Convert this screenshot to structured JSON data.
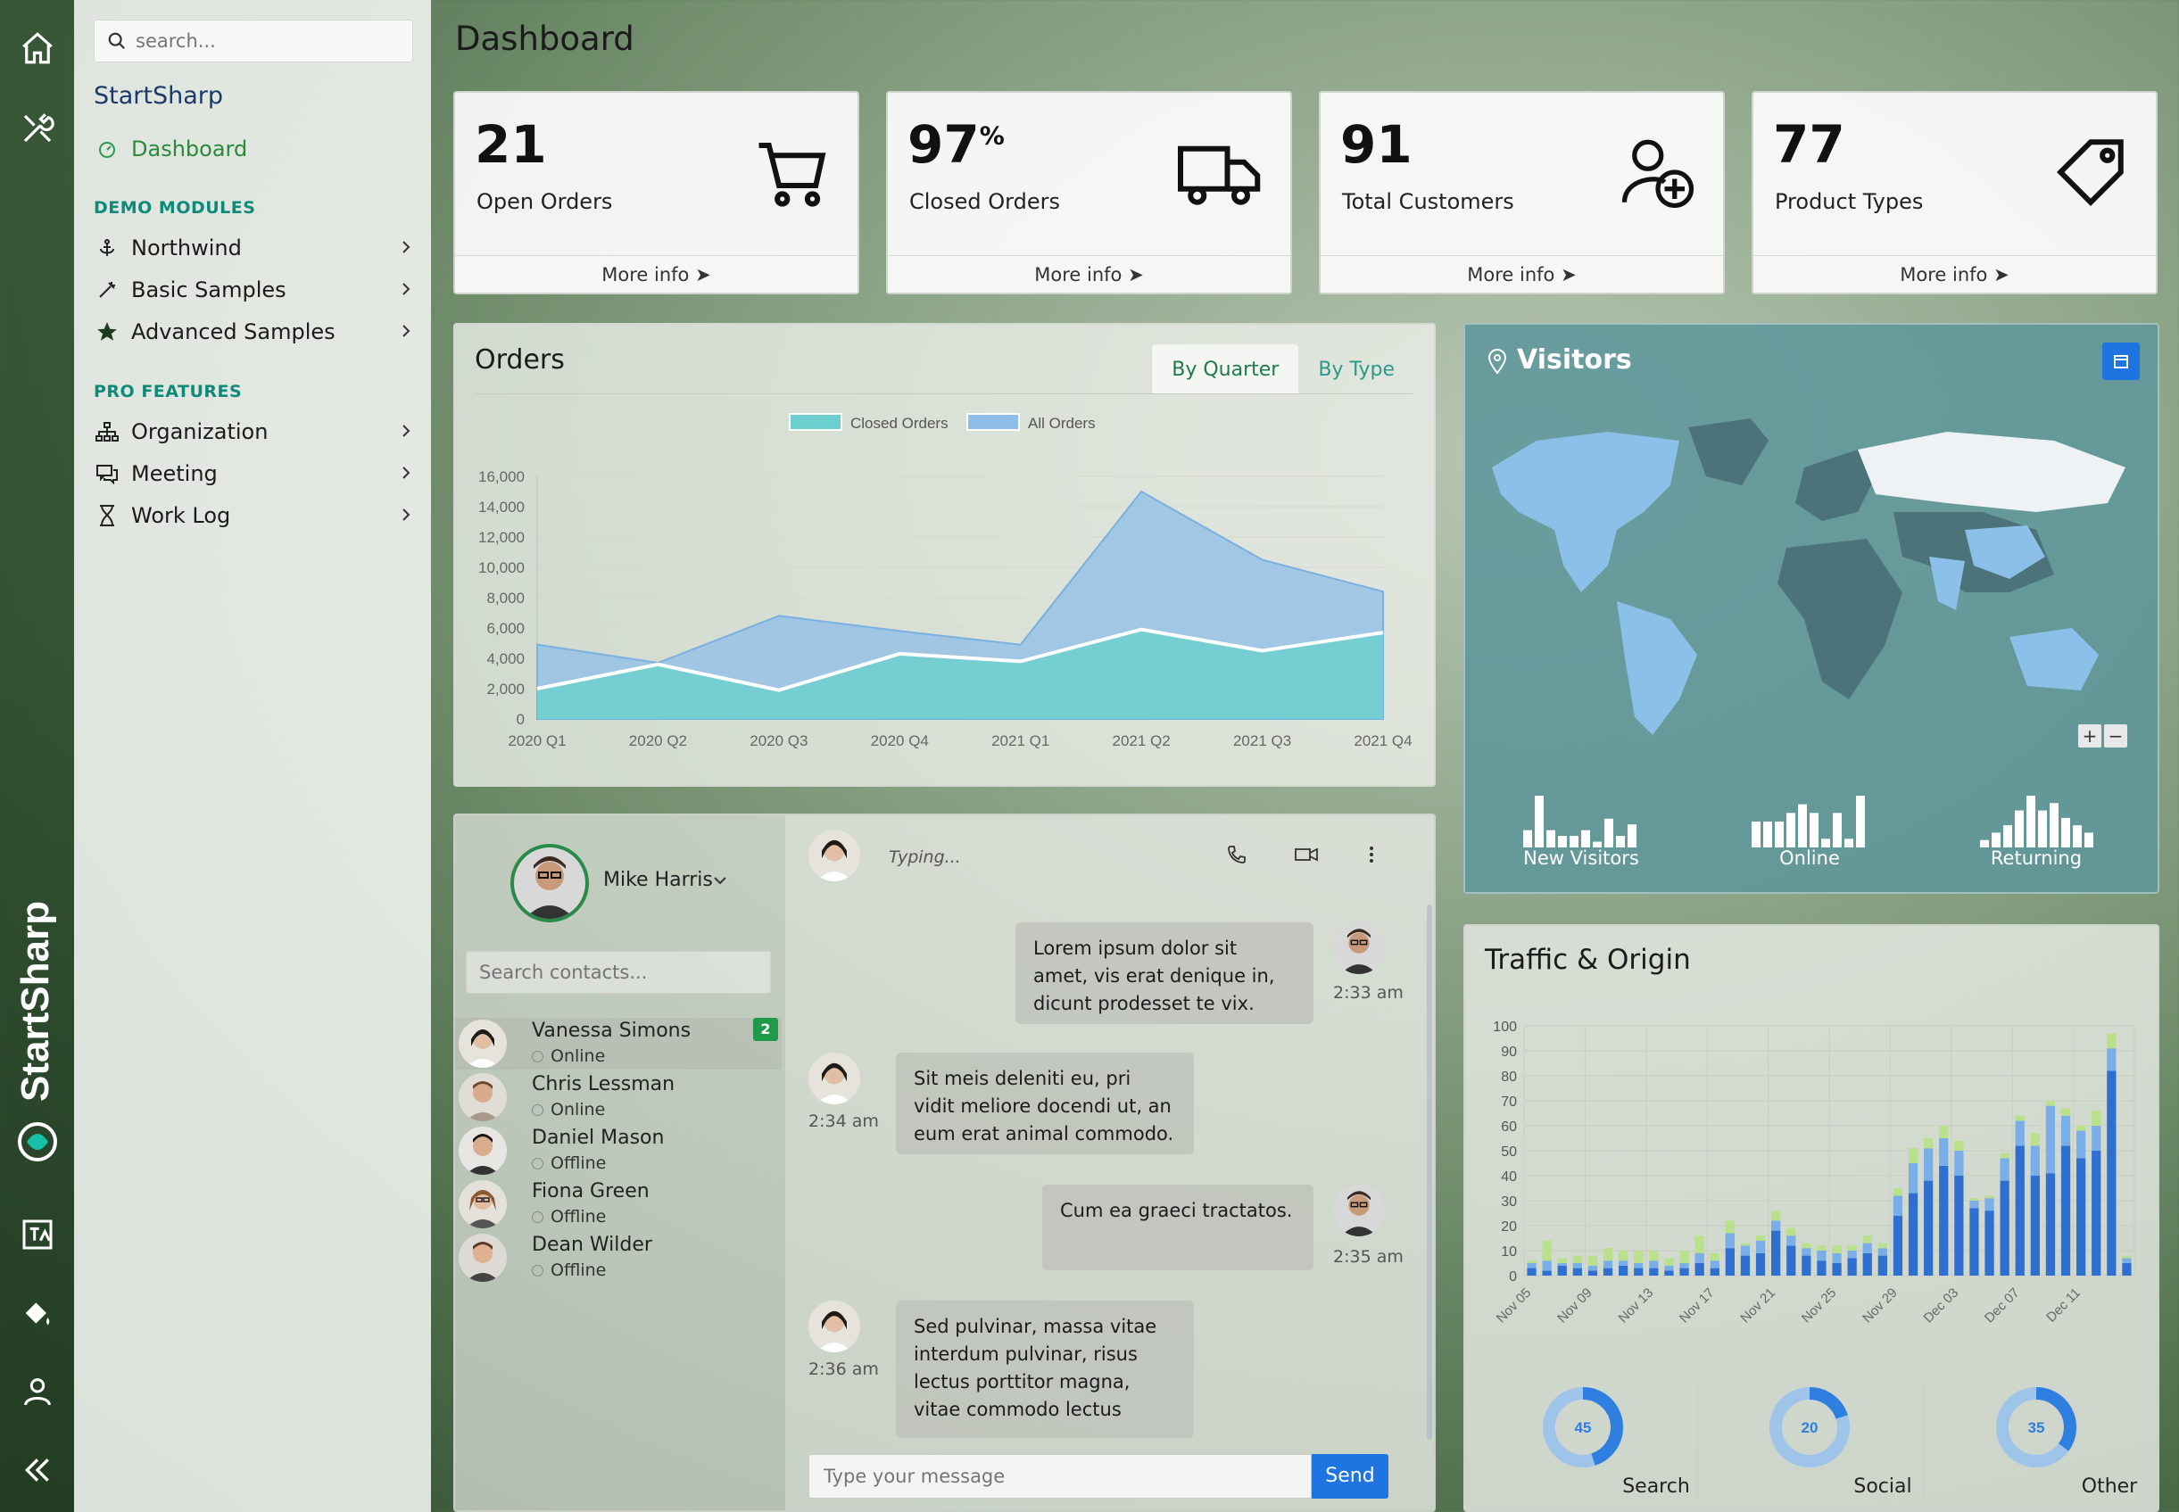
{
  "rail": {
    "brand_text": "StartSharp",
    "icons": [
      "home-icon",
      "tools-icon",
      "translate-icon",
      "paint-bucket-icon",
      "user-icon",
      "collapse-icon"
    ]
  },
  "sidebar": {
    "search_placeholder": "search...",
    "brand": "StartSharp",
    "dashboard_label": "Dashboard",
    "demo_heading": "DEMO MODULES",
    "demo_items": [
      {
        "label": "Northwind",
        "icon": "anchor-icon"
      },
      {
        "label": "Basic Samples",
        "icon": "magic-wand-icon"
      },
      {
        "label": "Advanced Samples",
        "icon": "star-icon"
      }
    ],
    "pro_heading": "PRO FEATURES",
    "pro_items": [
      {
        "label": "Organization",
        "icon": "sitemap-icon"
      },
      {
        "label": "Meeting",
        "icon": "chat-icon"
      },
      {
        "label": "Work Log",
        "icon": "hourglass-icon"
      }
    ]
  },
  "page": {
    "title": "Dashboard"
  },
  "stats": [
    {
      "value": "21",
      "suffix": "",
      "label": "Open Orders",
      "more": "More info",
      "icon": "cart-icon"
    },
    {
      "value": "97",
      "suffix": "%",
      "label": "Closed Orders",
      "more": "More info",
      "icon": "truck-icon"
    },
    {
      "value": "91",
      "suffix": "",
      "label": "Total Customers",
      "more": "More info",
      "icon": "add-user-icon"
    },
    {
      "value": "77",
      "suffix": "",
      "label": "Product Types",
      "more": "More info",
      "icon": "tag-icon"
    }
  ],
  "orders": {
    "title": "Orders",
    "tabs": [
      "By Quarter",
      "By Type"
    ],
    "active_tab": "By Quarter"
  },
  "chart_data": [
    {
      "type": "area",
      "categories": [
        "2020 Q1",
        "2020 Q2",
        "2020 Q3",
        "2020 Q4",
        "2021 Q1",
        "2021 Q2",
        "2021 Q3",
        "2021 Q4"
      ],
      "series": [
        {
          "name": "Closed Orders",
          "values": [
            2000,
            3600,
            1900,
            4300,
            3800,
            5900,
            4500,
            5700
          ],
          "color": "#6ccfcf"
        },
        {
          "name": "All Orders",
          "values": [
            4900,
            3700,
            6800,
            5800,
            4900,
            15000,
            10500,
            8400
          ],
          "color": "#8dbde8"
        }
      ],
      "ylim": [
        0,
        16000
      ],
      "yticks": [
        "0",
        "2,000",
        "4,000",
        "6,000",
        "8,000",
        "10,000",
        "12,000",
        "14,000",
        "16,000"
      ],
      "legend": "top",
      "grid": true
    },
    {
      "type": "bar",
      "stacked": true,
      "categories": [
        "Nov 05",
        "Nov 09",
        "Nov 13",
        "Nov 17",
        "Nov 21",
        "Nov 25",
        "Nov 29",
        "Dec 03",
        "Dec 07",
        "Dec 11"
      ],
      "x_count": 40,
      "series": [
        {
          "name": "Search",
          "color": "#2e6fd0",
          "values": [
            3,
            2,
            4,
            3,
            2,
            3,
            4,
            3,
            3,
            2,
            3,
            5,
            3,
            11,
            8,
            9,
            18,
            12,
            8,
            6,
            5,
            7,
            9,
            8,
            24,
            33,
            38,
            44,
            40,
            27,
            26,
            38,
            52,
            40,
            41,
            52,
            47,
            50,
            82,
            5
          ]
        },
        {
          "name": "Social",
          "color": "#7aaee8",
          "values": [
            2,
            4,
            1,
            2,
            2,
            3,
            2,
            2,
            3,
            2,
            2,
            4,
            3,
            6,
            4,
            5,
            4,
            4,
            3,
            4,
            4,
            3,
            4,
            3,
            8,
            12,
            13,
            11,
            10,
            3,
            5,
            9,
            10,
            12,
            27,
            12,
            11,
            10,
            9,
            2
          ]
        },
        {
          "name": "Other",
          "color": "#b9e08a",
          "values": [
            1,
            8,
            2,
            3,
            4,
            5,
            4,
            5,
            4,
            3,
            5,
            7,
            3,
            5,
            1,
            2,
            4,
            3,
            2,
            2,
            3,
            2,
            3,
            2,
            3,
            6,
            4,
            5,
            4,
            1,
            1,
            2,
            2,
            5,
            2,
            3,
            2,
            6,
            6,
            1
          ]
        }
      ],
      "ylim": [
        0,
        100
      ],
      "yticks": [
        "0",
        "10",
        "20",
        "30",
        "40",
        "50",
        "60",
        "70",
        "80",
        "90",
        "100"
      ],
      "grid": true
    }
  ],
  "visitors": {
    "title": "Visitors",
    "zoom_in": "+",
    "zoom_out": "−",
    "sparks": [
      {
        "label": "New Visitors",
        "values": [
          3,
          9,
          3,
          2,
          2,
          3,
          1,
          5,
          2,
          4
        ]
      },
      {
        "label": "Online",
        "values": [
          3,
          3,
          3,
          4,
          5,
          4,
          1,
          4,
          1,
          6
        ]
      },
      {
        "label": "Returning",
        "values": [
          1,
          2,
          3,
          5,
          7,
          5,
          6,
          4,
          3,
          2
        ]
      }
    ]
  },
  "traffic": {
    "title": "Traffic & Origin",
    "donuts": [
      {
        "label": "Search",
        "value": 45
      },
      {
        "label": "Social",
        "value": 20
      },
      {
        "label": "Other",
        "value": 35
      }
    ]
  },
  "chat": {
    "user_name": "Mike Harris",
    "search_placeholder": "Search contacts...",
    "typing": "Typing...",
    "contacts": [
      {
        "name": "Vanessa Simons",
        "status": "Online",
        "badge": "2"
      },
      {
        "name": "Chris Lessman",
        "status": "Online",
        "badge": ""
      },
      {
        "name": "Daniel Mason",
        "status": "Offline",
        "badge": ""
      },
      {
        "name": "Fiona Green",
        "status": "Offline",
        "badge": ""
      },
      {
        "name": "Dean Wilder",
        "status": "Offline",
        "badge": ""
      }
    ],
    "messages": [
      {
        "text": "Lorem ipsum dolor sit amet, vis erat denique in, dicunt prodesset te vix.",
        "time": "2:33 am",
        "side": "right"
      },
      {
        "text": "Sit meis deleniti eu, pri vidit meliore docendi ut, an eum erat animal commodo.",
        "time": "2:34 am",
        "side": "left"
      },
      {
        "text": "Cum ea graeci tractatos.",
        "time": "2:35 am",
        "side": "right"
      },
      {
        "text": "Sed pulvinar, massa vitae interdum pulvinar, risus lectus porttitor magna, vitae commodo lectus",
        "time": "2:36 am",
        "side": "left"
      }
    ],
    "input_placeholder": "Type your message",
    "send_label": "Send"
  }
}
